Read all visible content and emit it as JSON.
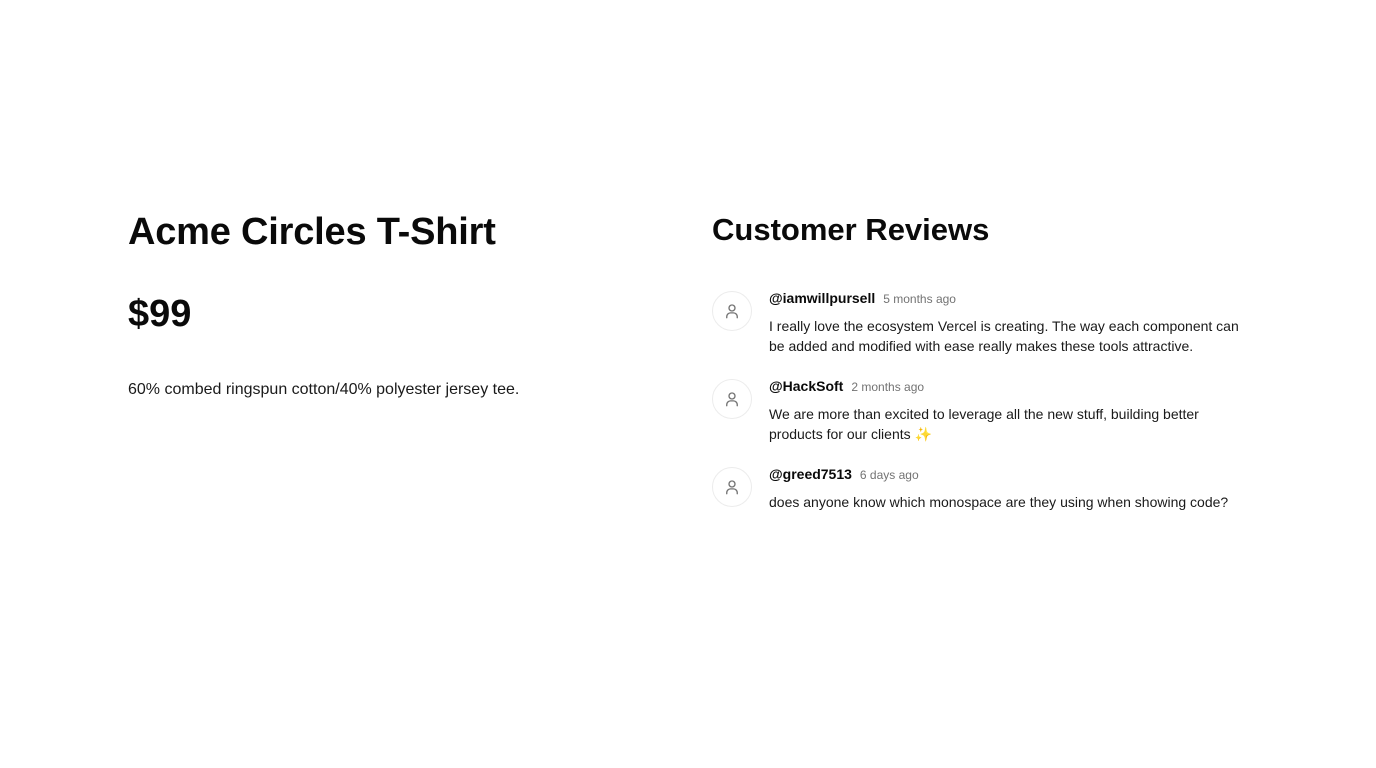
{
  "product": {
    "title": "Acme Circles T-Shirt",
    "price": "$99",
    "description": "60% combed ringspun cotton/40% polyester jersey tee."
  },
  "reviews": {
    "title": "Customer Reviews",
    "items": [
      {
        "user": "@iamwillpursell",
        "time": "5 months ago",
        "text": "I really love the ecosystem Vercel is creating. The way each component can be added and modified with ease really makes these tools attractive.",
        "avatar_icon": "user-icon"
      },
      {
        "user": "@HackSoft",
        "time": "2 months ago",
        "text": "We are more than excited to leverage all the new stuff, building better products for our clients ✨",
        "avatar_icon": "user-icon"
      },
      {
        "user": "@greed7513",
        "time": "6 days ago",
        "text": "does anyone know which monospace are they using when showing code?",
        "avatar_icon": "user-icon"
      }
    ]
  },
  "colors": {
    "text": "#0a0a0a",
    "muted": "#737373",
    "avatar_border": "#ececec",
    "background": "#ffffff"
  }
}
